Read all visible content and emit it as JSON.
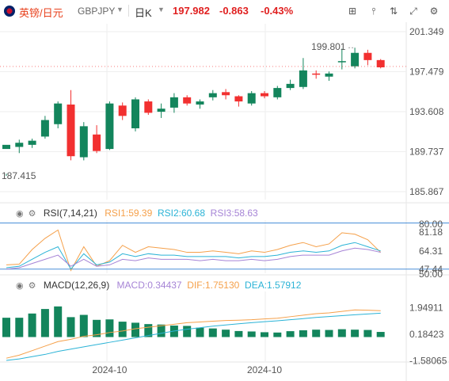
{
  "header": {
    "pair_name": "英镑/日元",
    "symbol": "GBPJPY",
    "period": "日K",
    "last_price": "197.982",
    "change": "-0.863",
    "change_pct": "-0.43%"
  },
  "toolbar": {
    "icons": [
      "drawing-tools-icon",
      "indicators-icon",
      "compare-icon",
      "fullscreen-icon",
      "settings-icon"
    ]
  },
  "colors": {
    "up": "#13855c",
    "down": "#f23030",
    "grid": "#eeeeee",
    "axis_text": "#555555",
    "rsi1": "#f5a04a",
    "rsi2": "#2bb3d6",
    "rsi3": "#a684d6",
    "dif": "#f5a04a",
    "dea": "#2bb3d6",
    "hist_up": "#13855c",
    "hist_down": "#f23030",
    "rsi_band": "#4a8fd8"
  },
  "chart_data": [
    {
      "type": "candlestick",
      "title": "GBPJPY 日K",
      "y_ticks": [
        "201.349",
        "197.479",
        "193.608",
        "189.737",
        "185.867"
      ],
      "ylim": [
        185.867,
        201.349
      ],
      "high_label": "199.801",
      "low_label": "187.415",
      "x_ticks": [
        {
          "label": "2024-10",
          "index": 8
        },
        {
          "label": "2024-10",
          "index": 20
        }
      ],
      "candles": [
        [
          190.0,
          190.4,
          187.6,
          187.4
        ],
        [
          190.2,
          190.6,
          189.6,
          190.9
        ],
        [
          190.4,
          190.8,
          190.1,
          191.0
        ],
        [
          191.2,
          192.8,
          191.0,
          193.2
        ],
        [
          192.4,
          194.4,
          192.0,
          194.6
        ],
        [
          194.3,
          189.3,
          188.9,
          195.7
        ],
        [
          189.2,
          192.2,
          188.9,
          192.6
        ],
        [
          191.4,
          189.8,
          189.6,
          192.3
        ],
        [
          190.0,
          194.4,
          189.9,
          194.6
        ],
        [
          194.2,
          193.2,
          192.8,
          194.5
        ],
        [
          192.0,
          194.8,
          191.7,
          195.0
        ],
        [
          194.6,
          193.5,
          193.3,
          194.8
        ],
        [
          193.6,
          193.9,
          193.0,
          194.4
        ],
        [
          194.0,
          195.0,
          193.5,
          195.4
        ],
        [
          195.0,
          194.4,
          194.2,
          195.2
        ],
        [
          194.3,
          194.6,
          193.9,
          194.8
        ],
        [
          195.0,
          195.4,
          194.7,
          195.7
        ],
        [
          195.5,
          195.2,
          194.8,
          195.8
        ],
        [
          195.1,
          194.6,
          194.1,
          195.2
        ],
        [
          194.4,
          195.4,
          194.2,
          195.6
        ],
        [
          195.4,
          195.1,
          194.9,
          195.6
        ],
        [
          195.0,
          195.9,
          194.8,
          196.1
        ],
        [
          195.9,
          196.3,
          195.7,
          196.7
        ],
        [
          196.0,
          197.6,
          195.8,
          198.8
        ],
        [
          197.3,
          197.2,
          196.8,
          197.6
        ],
        [
          197.0,
          197.3,
          196.6,
          197.5
        ],
        [
          198.5,
          198.5,
          197.7,
          199.7
        ],
        [
          198.0,
          199.3,
          197.8,
          199.8
        ],
        [
          199.3,
          198.6,
          198.1,
          199.6
        ],
        [
          198.6,
          197.9,
          197.8,
          198.7
        ]
      ]
    },
    {
      "type": "line",
      "name": "RSI",
      "params": "(7,14,21)",
      "values_text": {
        "RSI1": "59.39",
        "RSI2": "60.68",
        "RSI3": "58.63"
      },
      "y_ticks": [
        "80.00",
        "81.18",
        "64.31",
        "50.00",
        "47.44"
      ],
      "ylim": [
        44,
        82
      ],
      "band_high": 80,
      "band_low": 47,
      "series": [
        {
          "name": "RSI1",
          "values": [
            50,
            50.5,
            61,
            69,
            75,
            46,
            63,
            49,
            53,
            64,
            59,
            63,
            62,
            61,
            59,
            59,
            60,
            59,
            58,
            60,
            59,
            61,
            64,
            66,
            63,
            65,
            73,
            72,
            68,
            59
          ]
        },
        {
          "name": "RSI2",
          "values": [
            48,
            49,
            54,
            59,
            63,
            47,
            58,
            50,
            52,
            58,
            56,
            58,
            57,
            57,
            56,
            56,
            56,
            56,
            55,
            56,
            56,
            57,
            59,
            60,
            59,
            60,
            64,
            66,
            63,
            60
          ]
        },
        {
          "name": "RSI3",
          "values": [
            47,
            48,
            51,
            54,
            57,
            49,
            54,
            49,
            50,
            54,
            53,
            55,
            54,
            54,
            54,
            53,
            54,
            53,
            53,
            54,
            53,
            54,
            56,
            57,
            57,
            57,
            60,
            62,
            61,
            59
          ]
        }
      ]
    },
    {
      "type": "bar+line",
      "name": "MACD",
      "params": "(12,26,9)",
      "values_text": {
        "MACD": "0.34437",
        "DIF": "1.75130",
        "DEA": "1.57912"
      },
      "y_ticks": [
        "1.94911",
        "0.18423",
        "-1.58065"
      ],
      "ylim": [
        -1.6,
        2.6
      ],
      "histogram": [
        1.28,
        1.28,
        1.56,
        1.86,
        2.03,
        1.32,
        1.47,
        1.14,
        1.17,
        1.02,
        0.95,
        0.86,
        0.83,
        0.76,
        0.74,
        0.62,
        0.57,
        0.49,
        0.4,
        0.37,
        0.32,
        0.3,
        0.39,
        0.45,
        0.49,
        0.47,
        0.52,
        0.49,
        0.47,
        0.34
      ],
      "series": [
        {
          "name": "DIF",
          "values": [
            -1.4,
            -1.2,
            -0.9,
            -0.6,
            -0.3,
            -0.15,
            0.05,
            0.15,
            0.3,
            0.4,
            0.55,
            0.65,
            0.75,
            0.85,
            0.95,
            1.0,
            1.05,
            1.1,
            1.12,
            1.15,
            1.2,
            1.25,
            1.35,
            1.45,
            1.55,
            1.6,
            1.7,
            1.8,
            1.78,
            1.75
          ]
        },
        {
          "name": "DEA",
          "values": [
            -1.55,
            -1.45,
            -1.3,
            -1.15,
            -0.95,
            -0.8,
            -0.65,
            -0.5,
            -0.35,
            -0.2,
            -0.05,
            0.1,
            0.25,
            0.4,
            0.52,
            0.62,
            0.72,
            0.8,
            0.88,
            0.95,
            1.02,
            1.08,
            1.15,
            1.22,
            1.3,
            1.36,
            1.42,
            1.48,
            1.53,
            1.58
          ]
        }
      ]
    }
  ]
}
